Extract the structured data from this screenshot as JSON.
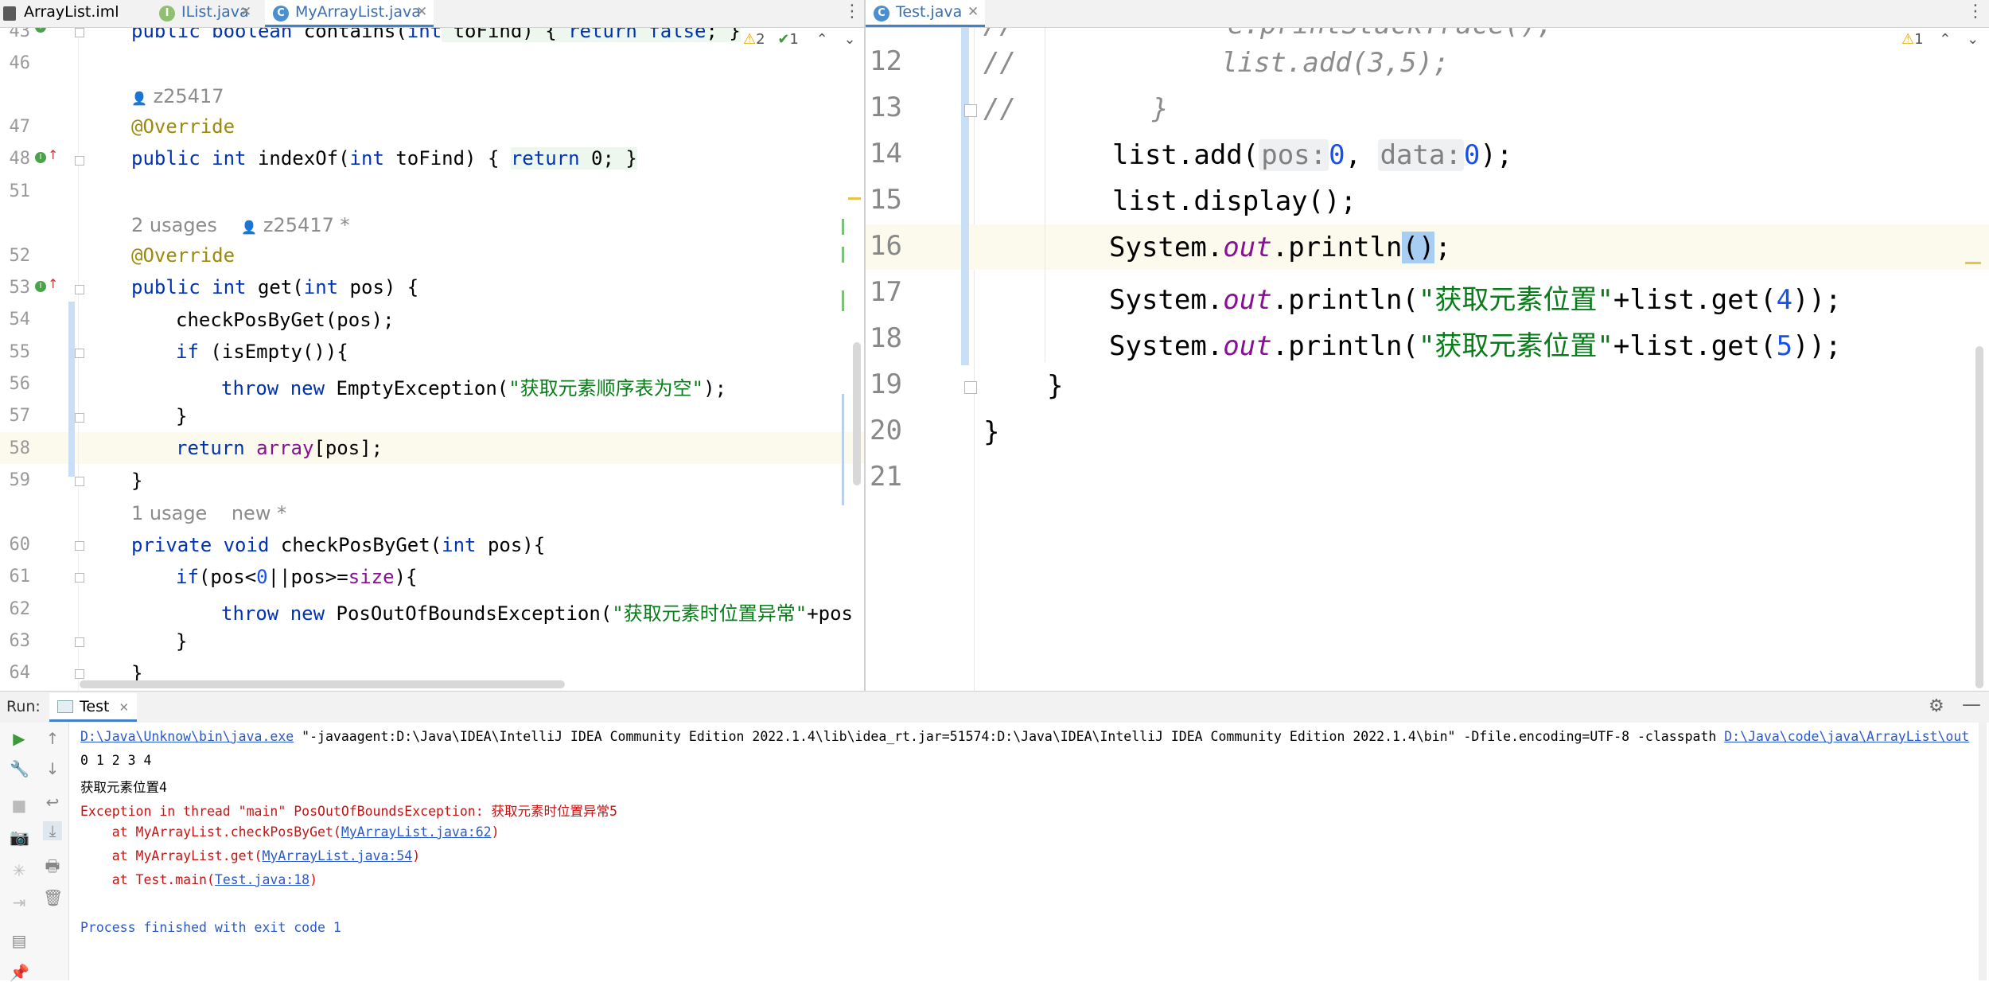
{
  "left_tabs": [
    {
      "label": "ArrayList.iml",
      "icon": "module-file-icon"
    },
    {
      "label": "IList.java",
      "icon": "interface-icon"
    },
    {
      "label": "MyArrayList.java",
      "icon": "class-icon",
      "active": true
    }
  ],
  "right_tabs": [
    {
      "label": "Test.java",
      "icon": "class-icon",
      "active": true
    }
  ],
  "left_editor": {
    "inspection": {
      "warnings": "2",
      "ok": "1"
    },
    "line_numbers": [
      "43",
      "46",
      "47",
      "48",
      "51",
      "52",
      "53",
      "54",
      "55",
      "56",
      "57",
      "58",
      "59",
      "60",
      "61",
      "62",
      "63",
      "64"
    ],
    "author_hints": {
      "a1": "z25417",
      "a2_usages": "2 usages",
      "a2_author": "z25417 *",
      "a3_usages": "1 usage",
      "a3_new": "new *"
    },
    "code": {
      "l43_kw": "public boolean",
      "l43_rest": " contains(",
      "l43_kw2": "int",
      "l43_rest2": " toFind) { ",
      "l43_kw3": "return false",
      "l43_rest3": "; }",
      "l47": "@Override",
      "l48_kw": "public int",
      "l48_rest": " indexOf(",
      "l48_kw2": "int",
      "l48_rest2": " toFind) { ",
      "l48_kw3": "return",
      "l48_rest3": " 0; }",
      "l52": "@Override",
      "l53_kw": "public int",
      "l53_rest": " get(",
      "l53_kw2": "int",
      "l53_rest2": " pos) {",
      "l54": "checkPosByGet(pos);",
      "l55_kw": "if",
      "l55_rest": " (isEmpty()){",
      "l56_kw": "throw new",
      "l56_rest": " EmptyException(",
      "l56_str": "\"获取元素顺序表为空\"",
      "l56_end": ");",
      "l57": "}",
      "l58_kw": "return",
      "l58_sp": " ",
      "l58_fld": "array",
      "l58_rest": "[pos];",
      "l59": "}",
      "l60_kw": "private void",
      "l60_rest": " checkPosByGet(",
      "l60_kw2": "int",
      "l60_rest2": " pos){",
      "l61_kw": "if",
      "l61_rest": "(pos<",
      "l61_num": "0",
      "l61_rest2": "||pos>=",
      "l61_fld": "size",
      "l61_rest3": "){",
      "l62_kw": "throw new",
      "l62_rest": " PosOutOfBoundsException(",
      "l62_str": "\"获取元素时位置异常\"",
      "l62_end": "+pos",
      "l63": "}",
      "l64": "}"
    }
  },
  "right_editor": {
    "inspection": {
      "warnings": "1"
    },
    "line_numbers": [
      "12",
      "13",
      "14",
      "15",
      "16",
      "17",
      "18",
      "19",
      "20",
      "21"
    ],
    "code": {
      "l11": "//             e.printStackTrace();",
      "l12_c": "//",
      "l12": "list.add(3,5);",
      "l13_c": "//",
      "l13": "}",
      "l14_a": "list.add(",
      "l14_h1": "pos:",
      "l14_n1": "0",
      "l14_sep": ", ",
      "l14_h2": "data:",
      "l14_n2": "0",
      "l14_end": ");",
      "l15": "list.display();",
      "l16_a": "System.",
      "l16_out": "out",
      "l16_b": ".println",
      "l16_paren": "()",
      "l16_end": ";",
      "l17_a": "System.",
      "l17_out": "out",
      "l17_b": ".println(",
      "l17_str": "\"获取元素位置\"",
      "l17_c": "+list.get(",
      "l17_num": "4",
      "l17_end": "));",
      "l18_a": "System.",
      "l18_out": "out",
      "l18_b": ".println(",
      "l18_str": "\"获取元素位置\"",
      "l18_c": "+list.get(",
      "l18_num": "5",
      "l18_end": "));",
      "l19": "}",
      "l20": "}"
    }
  },
  "run_panel": {
    "label": "Run:",
    "tab": "Test",
    "cmd_link": "D:\\Java\\Unknow\\bin\\java.exe",
    "cmd_rest": " \"-javaagent:D:\\Java\\IDEA\\IntelliJ IDEA Community Edition 2022.1.4\\lib\\idea_rt.jar=51574:D:\\Java\\IDEA\\IntelliJ IDEA Community Edition 2022.1.4\\bin\" -Dfile.encoding=UTF-8 -classpath ",
    "cmd_link2": "D:\\Java\\code\\java\\ArrayList\\out",
    "out1": "0 1 2 3 4",
    "out2": "获取元素位置4",
    "exc": "Exception in thread \"main\" PosOutOfBoundsException: 获取元素时位置异常5",
    "st1_pre": "    at MyArrayList.checkPosByGet(",
    "st1_link": "MyArrayList.java:62",
    "st1_end": ")",
    "st2_pre": "    at MyArrayList.get(",
    "st2_link": "MyArrayList.java:54",
    "st2_end": ")",
    "st3_pre": "    at Test.main(",
    "st3_link": "Test.java:18",
    "st3_end": ")",
    "finish": "Process finished with exit code 1"
  },
  "colors": {
    "accent": "#4083c9",
    "keyword": "#0033b3",
    "string": "#067d17",
    "annotation": "#9e880d",
    "error": "#c51414",
    "link": "#2a59c9"
  }
}
